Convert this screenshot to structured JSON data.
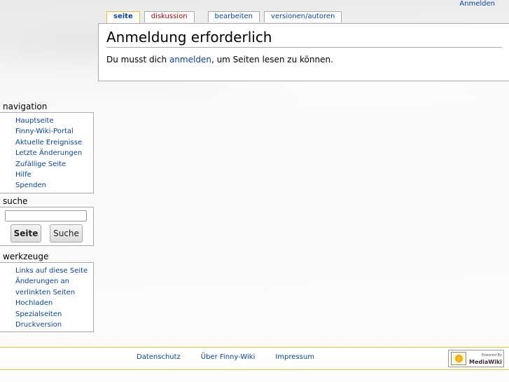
{
  "personal": {
    "login": "Anmelden"
  },
  "tabs": [
    {
      "label": "seite"
    },
    {
      "label": "diskussion"
    },
    {
      "label": "bearbeiten"
    },
    {
      "label": "versionen/autoren"
    }
  ],
  "content": {
    "title": "Anmeldung erforderlich",
    "text_before": "Du musst dich ",
    "link": "anmelden",
    "text_after": ", um Seiten lesen zu können."
  },
  "navigation": {
    "heading": "navigation",
    "items": [
      "Hauptseite",
      "Finny-Wiki-Portal",
      "Aktuelle Ereignisse",
      "Letzte Änderungen",
      "Zufällige Seite",
      "Hilfe",
      "Spenden"
    ]
  },
  "search": {
    "heading": "suche",
    "value": "",
    "go_label": "Seite",
    "find_label": "Suche"
  },
  "toolbox": {
    "heading": "werkzeuge",
    "items": [
      "Links auf diese Seite",
      "Änderungen an verlinkten Seiten",
      "Hochladen",
      "Spezialseiten",
      "Druckversion"
    ]
  },
  "footer": {
    "links": [
      "Datenschutz",
      "Über Finny-Wiki",
      "Impressum"
    ],
    "powered_small": "Powered By",
    "powered_big": "MediaWiki"
  }
}
